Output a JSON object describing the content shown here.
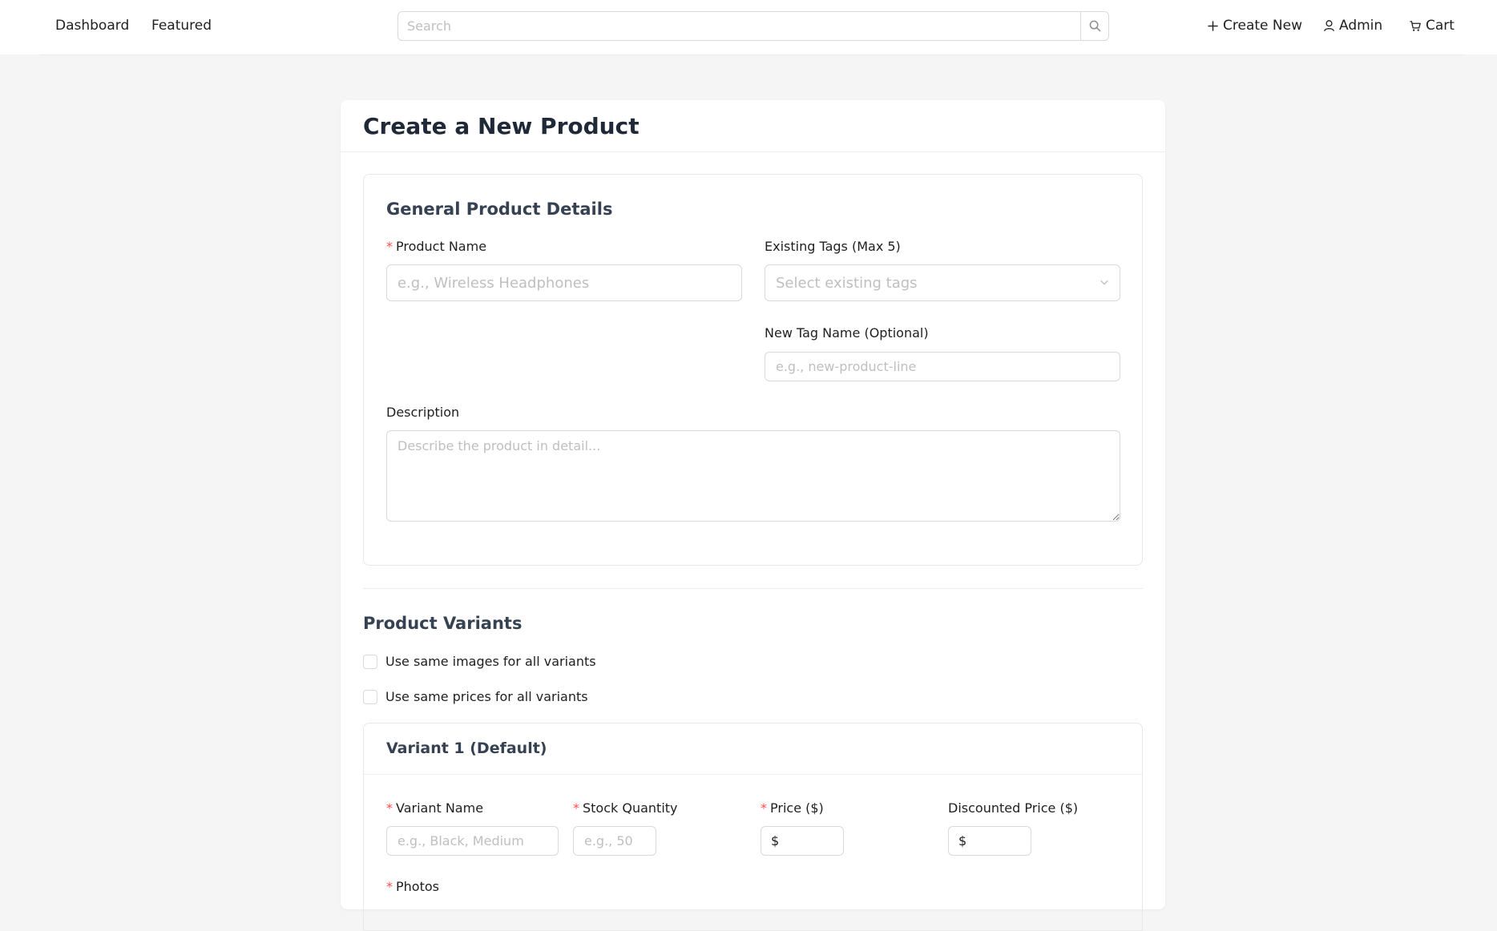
{
  "nav": {
    "dashboard": "Dashboard",
    "featured": "Featured",
    "search_placeholder": "Search",
    "create_new": "Create New",
    "admin": "Admin",
    "cart": "Cart"
  },
  "page": {
    "title": "Create a New Product"
  },
  "general": {
    "title": "General Product Details",
    "product_name_label": "Product Name",
    "product_name_placeholder": "e.g., Wireless Headphones",
    "tags_label": "Existing Tags (Max 5)",
    "tags_placeholder": "Select existing tags",
    "new_tag_label": "New Tag Name (Optional)",
    "new_tag_placeholder": "e.g., new-product-line",
    "description_label": "Description",
    "description_placeholder": "Describe the product in detail..."
  },
  "variants": {
    "title": "Product Variants",
    "same_images_label": "Use same images for all variants",
    "same_prices_label": "Use same prices for all variants",
    "variant_title": "Variant 1 (Default)",
    "variant_name_label": "Variant Name",
    "variant_name_placeholder": "e.g., Black, Medium",
    "stock_label": "Stock Quantity",
    "stock_placeholder": "e.g., 50",
    "price_label": "Price ($)",
    "discount_label": "Discounted Price ($)",
    "currency_prefix": "$",
    "photos_label": "Photos"
  },
  "required_marker": "*",
  "colors": {
    "required": "#ff4d4f",
    "heading": "#1f2937",
    "page_bg": "#f5f5f5"
  }
}
